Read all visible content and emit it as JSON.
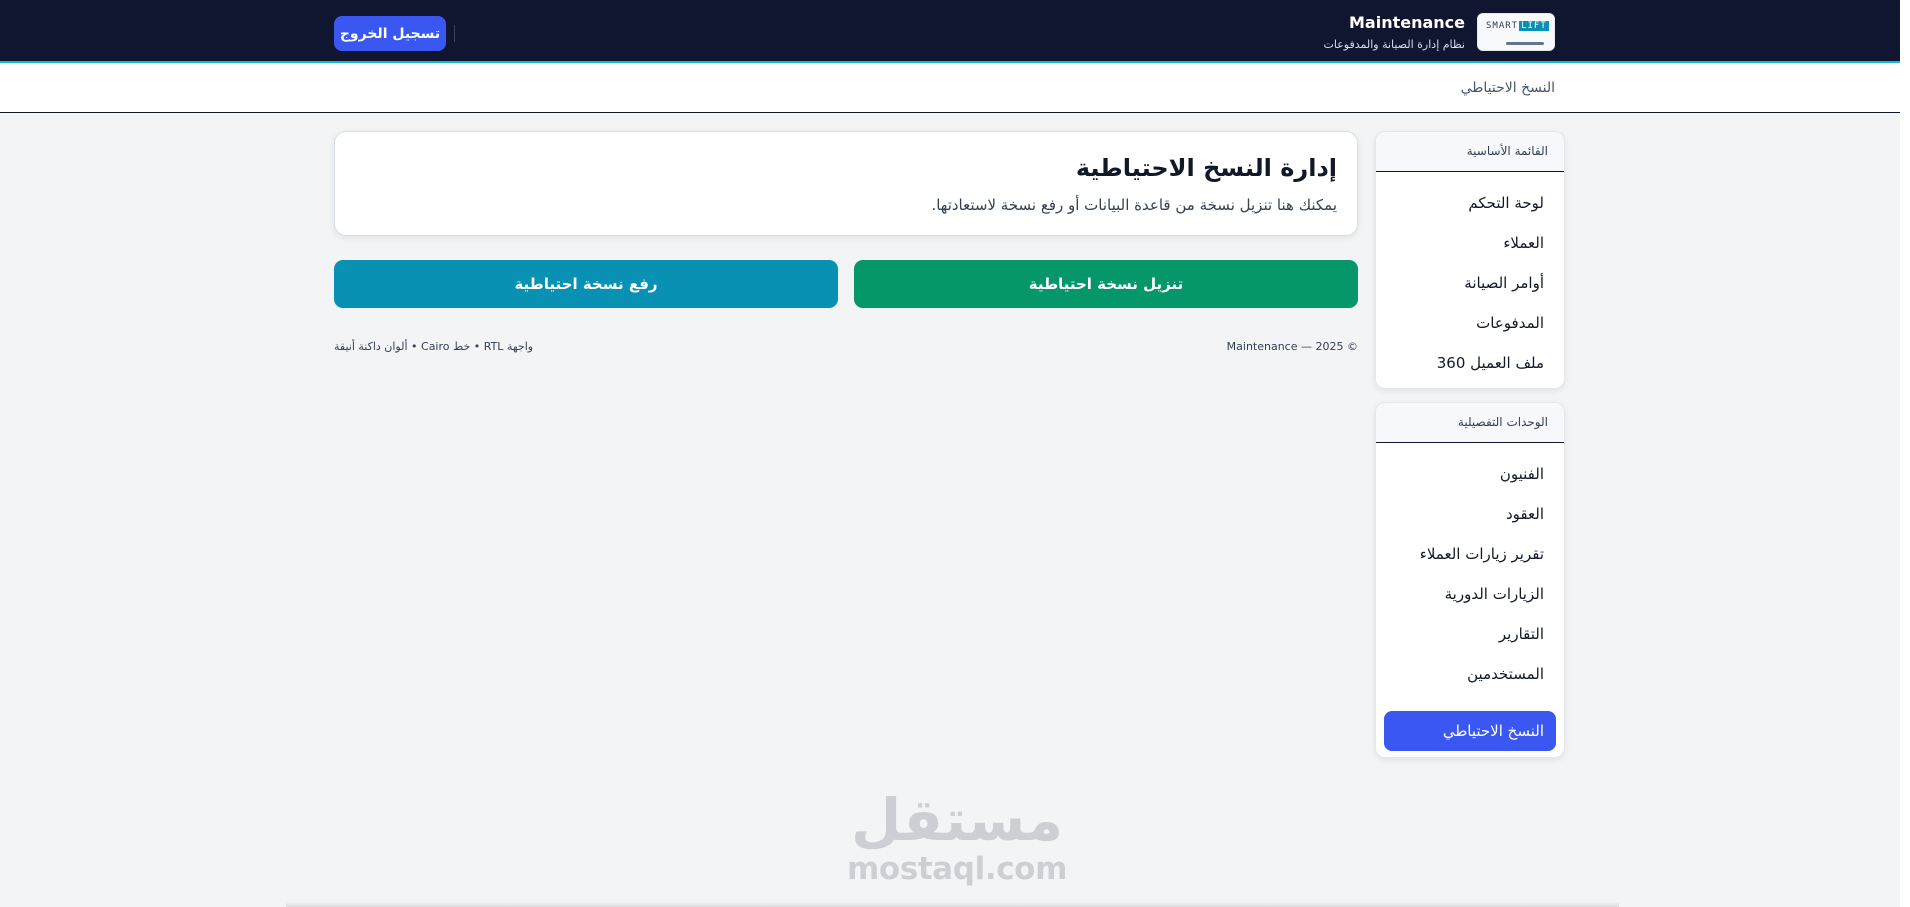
{
  "header": {
    "app_title": "Maintenance",
    "app_subtitle": "نظام إدارة الصيانة والمدفوعات",
    "logo_text": "SMART",
    "logo_highlight": "LIFT",
    "logout_label": "تسجيل الخروج"
  },
  "breadcrumb": {
    "current": "النسخ الاحتياطي"
  },
  "sidebar": {
    "main_title": "القائمة الأساسية",
    "main_items": [
      {
        "label": "لوحة التحكم"
      },
      {
        "label": "العملاء"
      },
      {
        "label": "أوامر الصيانة"
      },
      {
        "label": "المدفوعات"
      },
      {
        "label": "ملف العميل 360"
      }
    ],
    "details_title": "الوحدات التفصيلية",
    "detail_items": [
      {
        "label": "الفنيون"
      },
      {
        "label": "العقود"
      },
      {
        "label": "تقرير زيارات العملاء"
      },
      {
        "label": "الزيارات الدورية"
      },
      {
        "label": "التقارير"
      },
      {
        "label": "المستخدمين"
      },
      {
        "label": "النسخ الاحتياطي",
        "active": true
      }
    ]
  },
  "main": {
    "title": "إدارة النسخ الاحتياطية",
    "description": "يمكنك هنا تنزيل نسخة من قاعدة البيانات أو رفع نسخة لاستعادتها.",
    "download_label": "تنزيل نسخة احتياطية",
    "upload_label": "رفع نسخة احتياطية"
  },
  "footer": {
    "copyright": "© 2025 — Maintenance",
    "ui_note": "واجهة RTL • خط Cairo • ألوان داكنة أنيقة"
  },
  "watermark": {
    "arabic": "مستقل",
    "latin": "mostaql.com"
  },
  "colors": {
    "topbar": "#101630",
    "accent": "#3b57f2",
    "download": "#059669",
    "upload": "#0891b2",
    "page_background": "#f3f4f6"
  },
  "icons": {
    "logo": "smart-lift-logo"
  }
}
